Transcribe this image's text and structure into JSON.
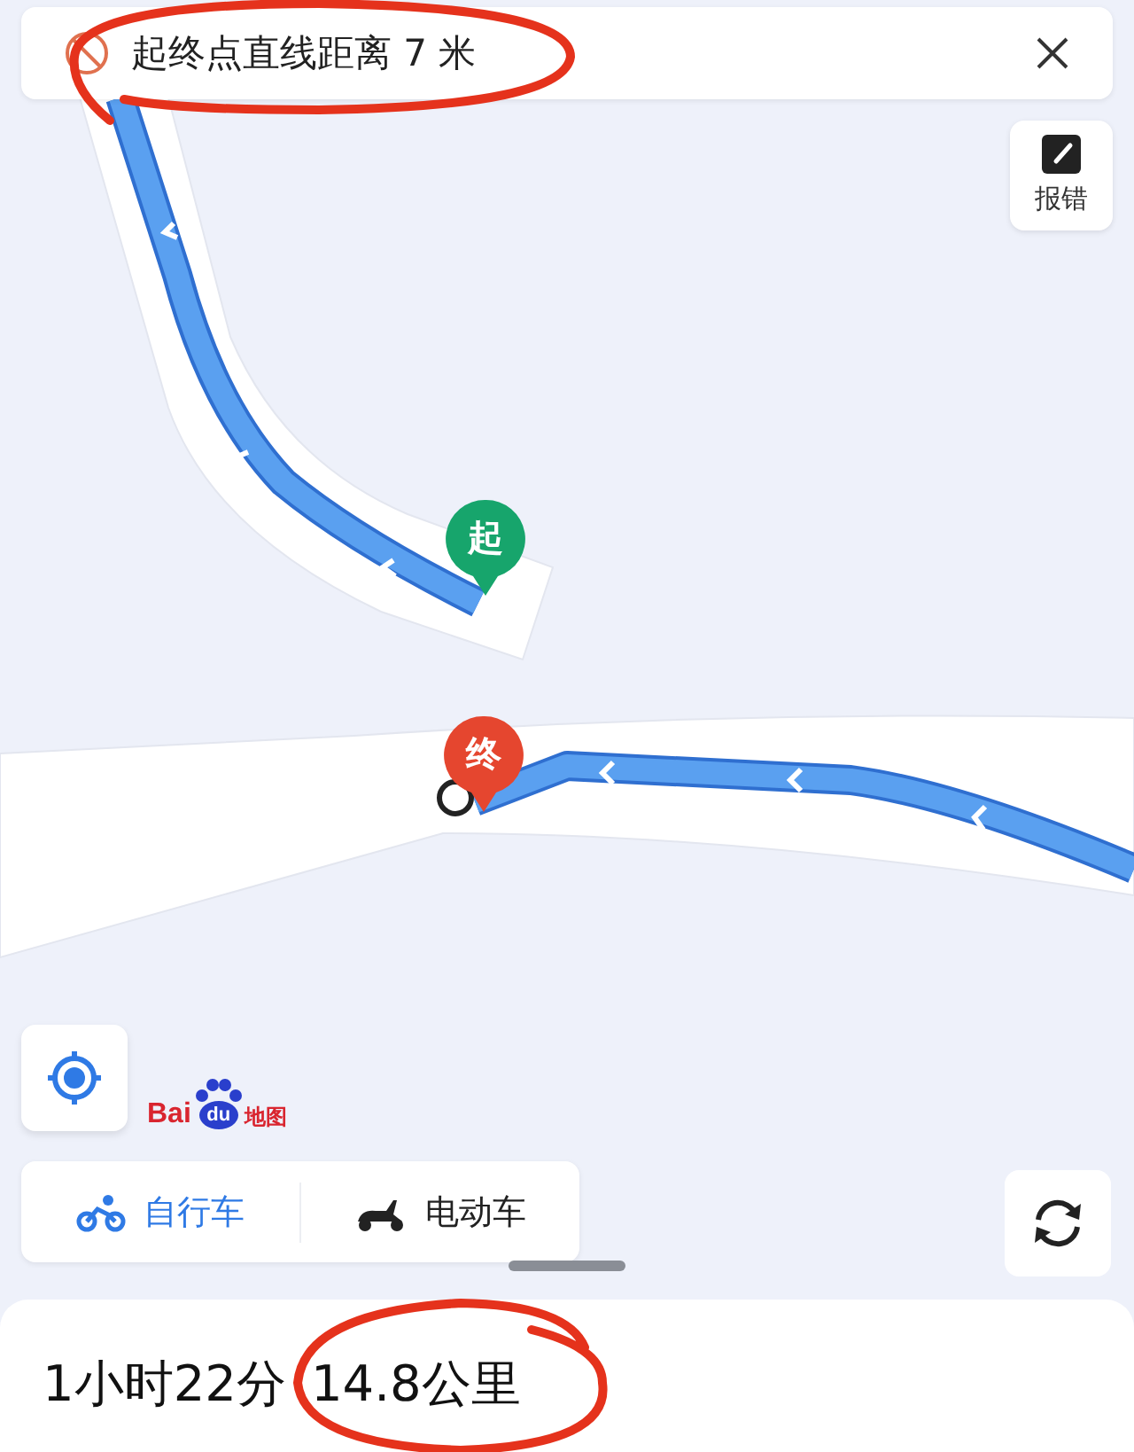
{
  "top_bar": {
    "message": "起终点直线距离 7 米"
  },
  "report_button": {
    "label": "报错"
  },
  "map": {
    "markers": [
      {
        "label": "起",
        "color": "#17a56c"
      },
      {
        "label": "终",
        "color": "#e5462f"
      }
    ]
  },
  "logo": {
    "prefix": "Bai",
    "paw_text": "du",
    "suffix": "地图"
  },
  "travel_modes": [
    {
      "kind": "bicycle",
      "label": "自行车",
      "selected": true
    },
    {
      "kind": "scooter",
      "label": "电动车",
      "selected": false
    }
  ],
  "summary": {
    "duration": "1小时22分",
    "distance": "14.8公里"
  }
}
